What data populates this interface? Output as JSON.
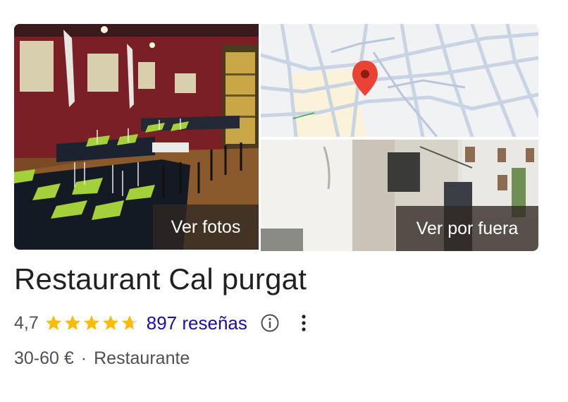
{
  "gallery": {
    "photos_button": "Ver fotos",
    "outside_button": "Ver por fuera"
  },
  "place": {
    "name": "Restaurant Cal purgat",
    "rating": "4,7",
    "rating_value": 4.7,
    "rating_max": 5,
    "reviews": "897 reseñas",
    "price": "30-60 €",
    "separator": "·",
    "category": "Restaurante"
  },
  "icons": {
    "star": "star-icon",
    "info": "info-icon",
    "more": "more-vert-icon",
    "pin": "map-pin-icon"
  },
  "colors": {
    "star": "#fbbc04",
    "star_empty": "#dadce0",
    "link": "#1a0dab",
    "pin": "#ea4335",
    "text": "#202124",
    "muted": "#4d5156"
  }
}
